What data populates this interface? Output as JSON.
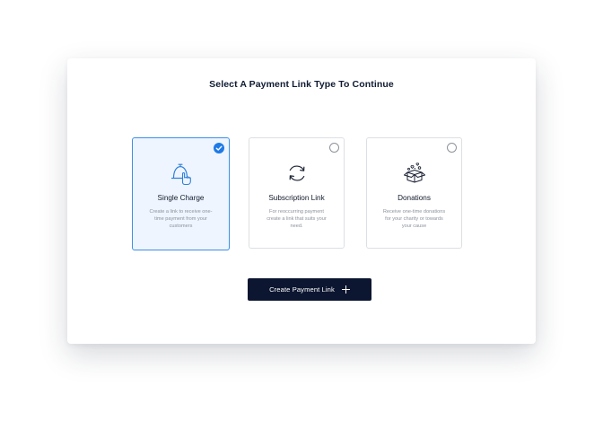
{
  "page": {
    "title": "Select A Payment Link Type To Continue"
  },
  "options": [
    {
      "title": "Single Charge",
      "description": "Create a link to receive one-time payment from your customers",
      "icon": "bell-hand-icon",
      "selected": true
    },
    {
      "title": "Subscription Link",
      "description": "For reoccurring payment create a link that suits your need.",
      "icon": "refresh-cycle-icon",
      "selected": false
    },
    {
      "title": "Donations",
      "description": "Receive one-time donations for your charity or towards your cause",
      "icon": "gift-box-icon",
      "selected": false
    }
  ],
  "actions": {
    "create_label": "Create Payment Link",
    "create_icon": "plus-icon"
  },
  "colors": {
    "accent": "#1e7ae6",
    "selected_bg": "#eef5ff",
    "button_bg": "#0d1630"
  }
}
